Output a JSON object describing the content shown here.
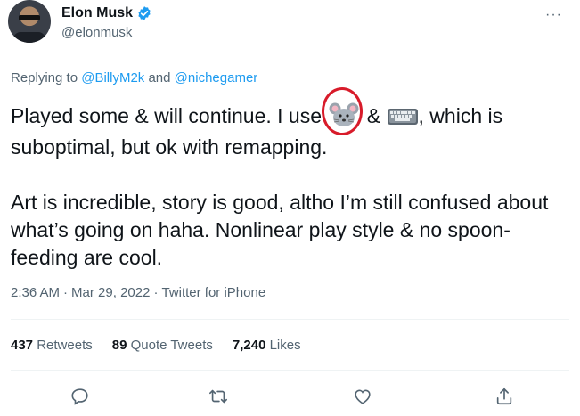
{
  "author": {
    "name": "Elon Musk",
    "handle": "@elonmusk",
    "verified": true
  },
  "reply": {
    "prefix": "Replying to",
    "users": [
      "@BillyM2k",
      "@nichegamer"
    ],
    "joiner": "and"
  },
  "tweet": {
    "line1_a": "Played some & will continue. I use",
    "emoji_mouse": "mouse-face-emoji",
    "line1_b": "&",
    "emoji_keyboard": "keyboard-emoji",
    "line1_c": ", which is suboptimal, but ok with remapping.",
    "paragraph2": "Art is incredible, story is good, altho I’m still confused about what’s going on haha. Nonlinear play style & no spoon-feeding are cool."
  },
  "meta": {
    "time": "2:36 AM",
    "date": "Mar 29, 2022",
    "source": "Twitter for iPhone",
    "dot": "·"
  },
  "stats": {
    "retweets_count": "437",
    "retweets_label": "Retweets",
    "quotes_count": "89",
    "quotes_label": "Quote Tweets",
    "likes_count": "7,240",
    "likes_label": "Likes"
  },
  "actions": [
    "reply-icon",
    "retweet-icon",
    "like-icon",
    "share-icon"
  ],
  "colors": {
    "accent": "#1d9bf0",
    "secondary_text": "#536471",
    "annotation_circle": "#d81b2a"
  }
}
